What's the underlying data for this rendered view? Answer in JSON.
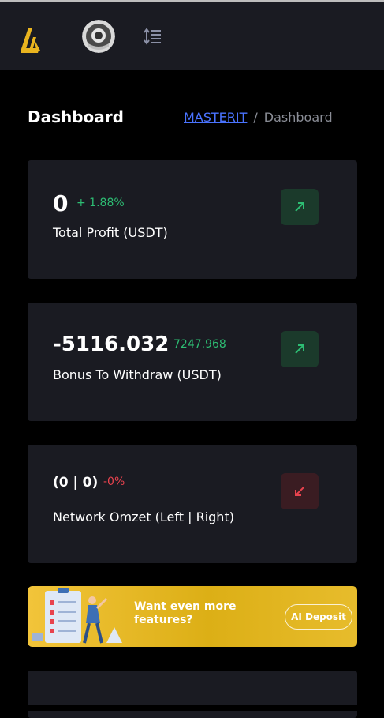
{
  "header": {
    "logo_icon": "brand-logo-icon",
    "avatar_icon": "user-avatar-icon",
    "menu_icon": "menu-toggle-icon"
  },
  "page": {
    "title": "Dashboard",
    "breadcrumb": {
      "link": "MASTERIT",
      "separator": "/",
      "current": "Dashboard"
    }
  },
  "cards": [
    {
      "value": "0",
      "change": "+ 1.88%",
      "change_color": "#2dbd73",
      "label": "Total Profit (USDT)",
      "trend_icon": "arrow-up-right-icon",
      "trend_color": "#2dbd73"
    },
    {
      "value": "-5116.032",
      "change": "7247.968",
      "change_color": "#2dbd73",
      "label": "Bonus To Withdraw (USDT)",
      "trend_icon": "arrow-up-right-icon",
      "trend_color": "#2dbd73"
    },
    {
      "value": "(0 | 0)",
      "change": "-0%",
      "change_color": "#e8434e",
      "label": "Network Omzet (Left | Right)",
      "trend_icon": "arrow-down-left-icon",
      "trend_color": "#e8434e"
    }
  ],
  "banner": {
    "text": "Want even more features?",
    "button_label": "AI Deposit",
    "illustration_icon": "checklist-illustration-icon"
  },
  "colors": {
    "background": "#000000",
    "card": "#1a1b22",
    "link": "#4a73ff",
    "positive": "#2dbd73",
    "negative": "#e8434e",
    "banner": "#e0b21f"
  }
}
